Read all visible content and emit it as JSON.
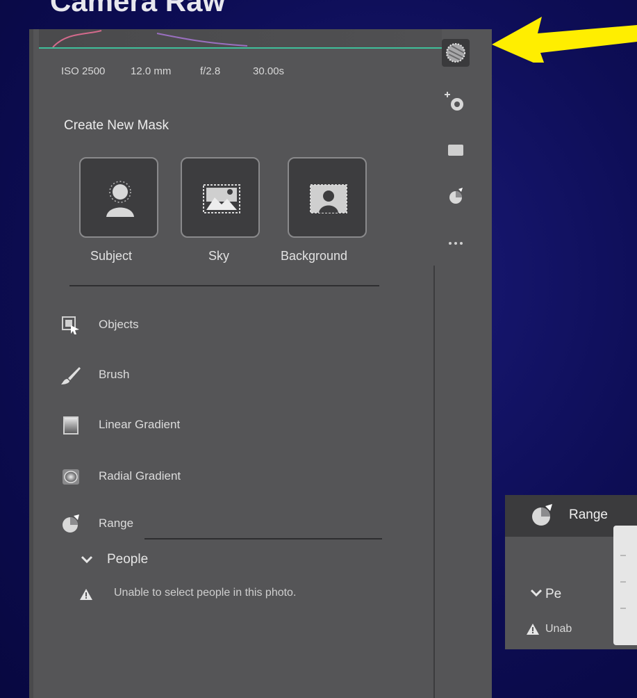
{
  "slide": {
    "title": "Camera Raw",
    "arrow_color": "#ffee00"
  },
  "exif": {
    "iso": "ISO 2500",
    "focal_length": "12.0 mm",
    "aperture": "f/2.8",
    "shutter": "30.00s"
  },
  "masking": {
    "title": "Create New Mask",
    "presets": [
      {
        "label": "Subject",
        "icon": "subject-person-icon"
      },
      {
        "label": "Sky",
        "icon": "sky-landscape-icon"
      },
      {
        "label": "Background",
        "icon": "background-person-icon"
      }
    ],
    "tools": [
      {
        "label": "Objects",
        "icon": "objects-icon"
      },
      {
        "label": "Brush",
        "icon": "brush-icon"
      },
      {
        "label": "Linear Gradient",
        "icon": "linear-gradient-icon"
      },
      {
        "label": "Radial Gradient",
        "icon": "radial-gradient-icon"
      },
      {
        "label": "Range",
        "icon": "range-icon"
      }
    ],
    "people": {
      "label": "People",
      "warning": "Unable to select people in this photo."
    }
  },
  "right_rail": {
    "items": [
      "masking-icon",
      "healing-icon",
      "red-eye-icon",
      "presets-icon",
      "more-icon"
    ]
  },
  "inset": {
    "range_label": "Range",
    "people_label": "Pe",
    "warning_fragment": "Unab"
  },
  "colors": {
    "accent_line": "#3fbf9a",
    "panel": "#555557",
    "background": "#0d0d55"
  }
}
